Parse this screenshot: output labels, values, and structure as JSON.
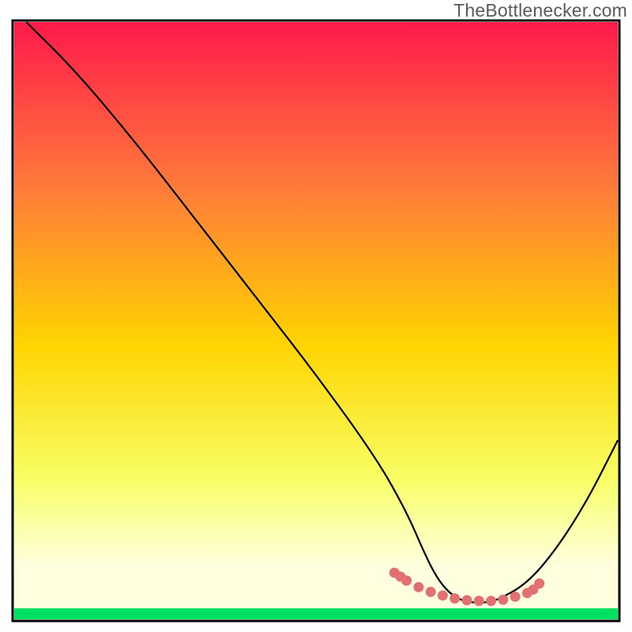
{
  "watermark": "TheBottlenecker.com",
  "chart_data": {
    "type": "line",
    "title": "",
    "xlabel": "",
    "ylabel": "",
    "xlim": [
      0,
      100
    ],
    "ylim": [
      0,
      100
    ],
    "grid": false,
    "gradient": {
      "top": "#ff1a4b",
      "upper_mid": "#ff7a3a",
      "mid": "#ffd400",
      "lower_mid": "#f8ff66",
      "near_bottom": "#ffffe0",
      "bottom_band": "#00e060"
    },
    "series": [
      {
        "name": "curve",
        "color": "#000000",
        "x": [
          2,
          10,
          20,
          30,
          40,
          50,
          60,
          65,
          68,
          70,
          72,
          74,
          76,
          78,
          80,
          85,
          90,
          95,
          100
        ],
        "y": [
          100,
          92,
          80,
          67,
          54,
          41,
          27,
          18,
          11,
          7,
          4.5,
          3.2,
          2.8,
          2.8,
          3.2,
          6,
          12,
          20,
          30
        ]
      },
      {
        "name": "optimal-segment",
        "color": "#e37070",
        "style": "dotted-thick",
        "x": [
          63,
          65,
          67,
          69,
          71,
          73,
          75,
          77,
          79,
          81,
          83,
          85,
          86,
          87
        ],
        "y": [
          7.8,
          6.5,
          5.4,
          4.6,
          4.0,
          3.5,
          3.2,
          3.1,
          3.1,
          3.3,
          3.8,
          4.4,
          5.0,
          6.0
        ]
      }
    ]
  }
}
